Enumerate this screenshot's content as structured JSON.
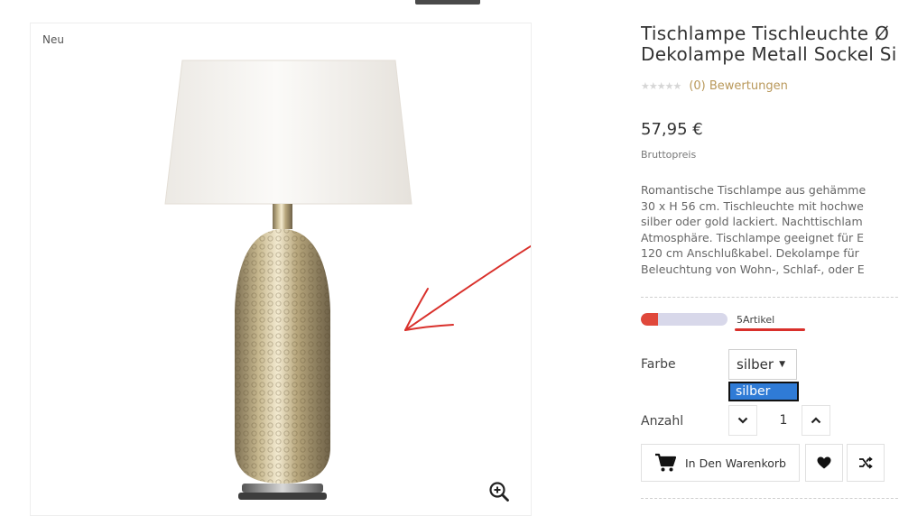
{
  "product": {
    "badge": "Neu",
    "title_line1": "Tischlampe Tischleuchte Ø",
    "title_line2": "Dekolampe Metall Sockel Si",
    "reviews_text": "(0) Bewertungen",
    "stars": "★★★★★",
    "price": "57,95 €",
    "price_note": "Bruttopreis",
    "description_lines": [
      "Romantische Tischlampe aus gehämme",
      "30 x H 56 cm. Tischleuchte mit hochwe",
      "silber oder gold lackiert. Nachttischlam",
      "Atmosphäre. Tischlampe geeignet für E",
      "120 cm Anschlußkabel. Dekolampe für",
      "Beleuchtung von Wohn-, Schlaf-, oder E"
    ],
    "stock_text": "5Artikel",
    "stock_level": 0.2
  },
  "options": {
    "color_label": "Farbe",
    "color_selected": "silber",
    "color_dropdown_option": "silber",
    "qty_label": "Anzahl",
    "qty_value": "1"
  },
  "actions": {
    "cart_label": "In Den Warenkorb"
  },
  "colors": {
    "accent_red": "#e0483b",
    "stars": "#d6d6d6",
    "reviews_link": "#b9985a",
    "dropdown_highlight": "#2f7bd6"
  },
  "icons": [
    "zoom-in-icon",
    "cart-icon",
    "heart-icon",
    "shuffle-icon",
    "chevron-down-icon",
    "chevron-up-icon",
    "caret-down-icon"
  ]
}
